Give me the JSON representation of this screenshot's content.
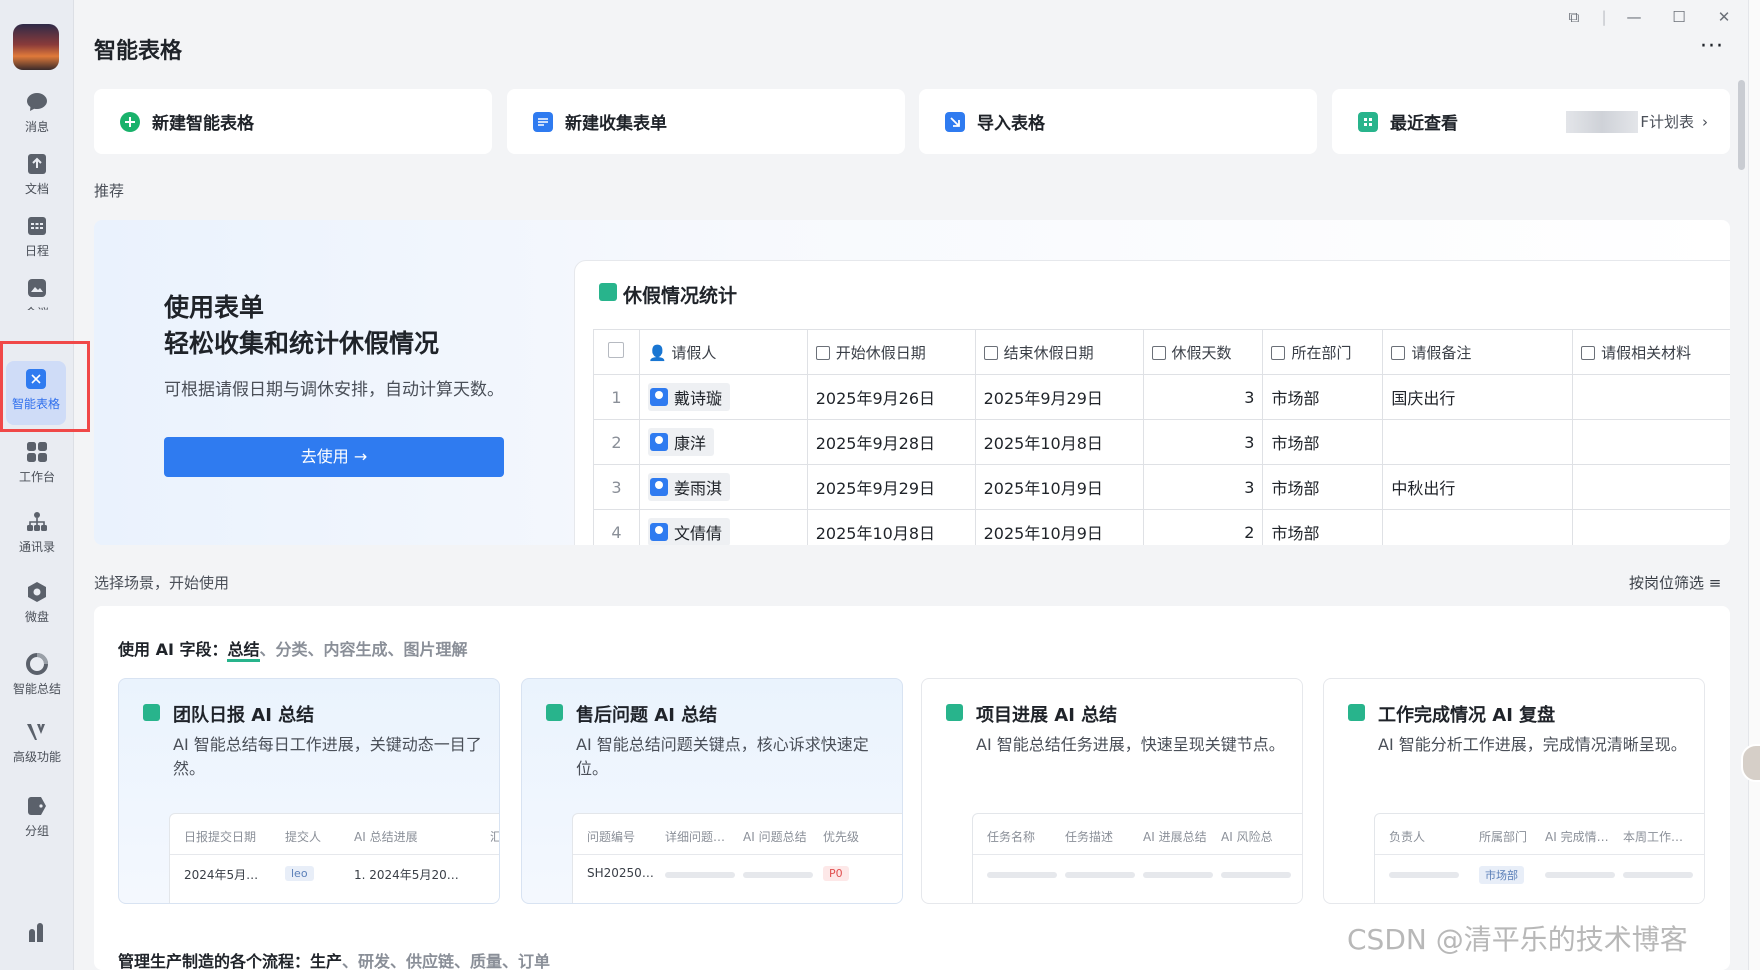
{
  "sidebar": {
    "items": [
      {
        "label": "消息",
        "icon": "chat-bubble-icon"
      },
      {
        "label": "文档",
        "icon": "document-icon"
      },
      {
        "label": "日程",
        "icon": "calendar-icon"
      },
      {
        "label": "会议",
        "icon": "meeting-icon"
      },
      {
        "label": "智能表格",
        "icon": "smart-sheet-icon",
        "active": true
      },
      {
        "label": "工作台",
        "icon": "grid-apps-icon"
      },
      {
        "label": "通讯录",
        "icon": "org-chart-icon"
      },
      {
        "label": "微盘",
        "icon": "drive-icon"
      },
      {
        "label": "智能总结",
        "icon": "summary-icon"
      },
      {
        "label": "高级功能",
        "icon": "advanced-icon"
      },
      {
        "label": "分组",
        "icon": "tag-icon"
      }
    ]
  },
  "window": {
    "title": "智能表格",
    "more": "···"
  },
  "actions": [
    {
      "label": "新建智能表格",
      "color": "#19b26b"
    },
    {
      "label": "新建收集表单",
      "color": "#2f7bf0"
    },
    {
      "label": "导入表格",
      "color": "#2f7bf0"
    },
    {
      "label": "最近查看",
      "color": "#28b48c",
      "recent": "F计划表"
    }
  ],
  "recommend": {
    "label": "推荐",
    "headline1": "使用表单",
    "headline2": "轻松收集和统计休假情况",
    "desc": "可根据请假日期与调休安排，自动计算天数。",
    "button": "去使用 →",
    "sheet_title": "休假情况统计",
    "columns": [
      "请假人",
      "开始休假日期",
      "结束休假日期",
      "休假天数",
      "所在部门",
      "请假备注",
      "请假相关材料"
    ],
    "rows": [
      {
        "no": "1",
        "name": "戴诗璇",
        "start": "2025年9月26日",
        "end": "2025年9月29日",
        "days": "3",
        "dept": "市场部",
        "note": "国庆出行"
      },
      {
        "no": "2",
        "name": "康洋",
        "start": "2025年9月28日",
        "end": "2025年10月8日",
        "days": "3",
        "dept": "市场部",
        "note": ""
      },
      {
        "no": "3",
        "name": "姜雨淇",
        "start": "2025年9月29日",
        "end": "2025年10月9日",
        "days": "3",
        "dept": "市场部",
        "note": "中秋出行"
      },
      {
        "no": "4",
        "name": "文倩倩",
        "start": "2025年10月8日",
        "end": "2025年10月9日",
        "days": "2",
        "dept": "市场部",
        "note": ""
      }
    ]
  },
  "scenario": {
    "label": "选择场景，开始使用",
    "filter": "按岗位筛选",
    "ai_prefix": "使用 AI 字段：",
    "ai_selected": "总结",
    "ai_rest": "、分类、内容生成、图片理解",
    "cards": [
      {
        "title": "团队日报 AI 总结",
        "desc": "AI 智能总结每日工作进展，关键动态一目了然。",
        "headers": [
          "日报提交日期",
          "提交人",
          "AI 总结进展",
          "汇"
        ],
        "values": [
          "2024年5月…",
          "leo",
          "1. 2024年5月20…"
        ]
      },
      {
        "title": "售后问题 AI 总结",
        "desc": "AI 智能总结问题关键点，核心诉求快速定位。",
        "headers": [
          "问题编号",
          "详细问题…",
          "AI 问题总结",
          "优先级"
        ],
        "values": [
          "SH20250…",
          "P0"
        ]
      },
      {
        "title": "项目进展 AI 总结",
        "desc": "AI 智能总结任务进展，快速呈现关键节点。",
        "headers": [
          "任务名称",
          "任务描述",
          "AI 进展总结",
          "AI 风险总"
        ],
        "values": []
      },
      {
        "title": "工作完成情况 AI 复盘",
        "desc": "AI 智能分析工作进展，完成情况清晰呈现。",
        "headers": [
          "负责人",
          "所属部门",
          "AI 完成情…",
          "本周工作…"
        ],
        "values": [
          "市场部"
        ]
      }
    ],
    "bottom_prefix": "管理生产制造的各个流程：",
    "bottom_selected": "生产",
    "bottom_rest": "、研发、供应链、质量、订单"
  },
  "watermark": "CSDN @清平乐的技术博客"
}
